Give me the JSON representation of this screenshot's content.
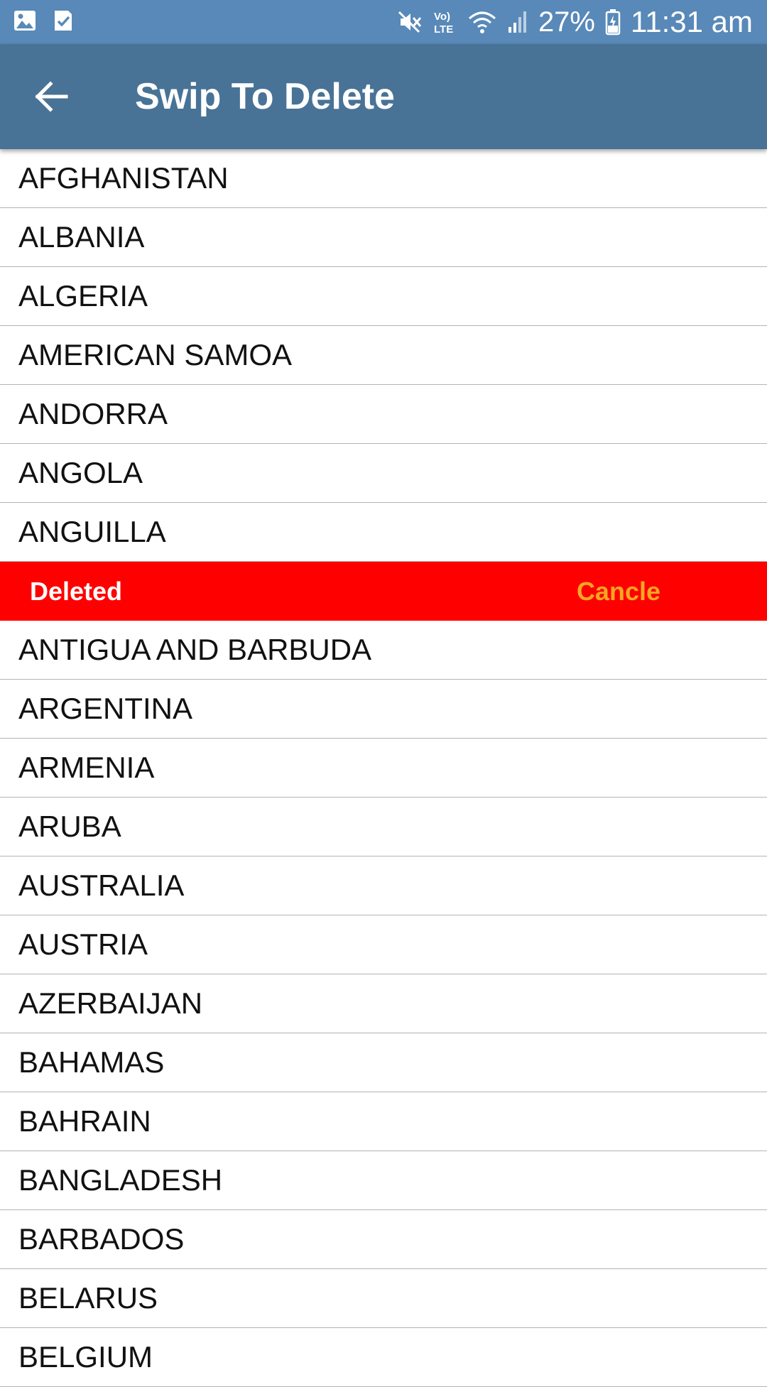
{
  "status_bar": {
    "battery_percent": "27%",
    "time": "11:31 am",
    "left_icons": [
      "gallery-icon",
      "check-notification-icon"
    ],
    "right_icons": [
      "mute-icon",
      "volte-icon",
      "wifi-icon",
      "signal-icon",
      "battery-charging-icon"
    ],
    "volte_top": "Vo)",
    "volte_bottom": "LTE"
  },
  "app_bar": {
    "title": "Swip To Delete",
    "back_icon": "arrow-left-icon",
    "background": "#487396"
  },
  "colors": {
    "status_bar": "#5889b8",
    "delete_row": "#ff0000",
    "cancel_text": "#f5a623"
  },
  "list": {
    "items_before": [
      "AFGHANISTAN",
      "ALBANIA",
      "ALGERIA",
      "AMERICAN SAMOA",
      "ANDORRA",
      "ANGOLA",
      "ANGUILLA"
    ],
    "swiped_row": {
      "deleted_label": "Deleted",
      "cancel_label": "Cancle"
    },
    "items_after": [
      "ANTIGUA AND BARBUDA",
      "ARGENTINA",
      "ARMENIA",
      "ARUBA",
      "AUSTRALIA",
      "AUSTRIA",
      "AZERBAIJAN",
      "BAHAMAS",
      "BAHRAIN",
      "BANGLADESH",
      "BARBADOS",
      "BELARUS",
      "BELGIUM"
    ]
  }
}
